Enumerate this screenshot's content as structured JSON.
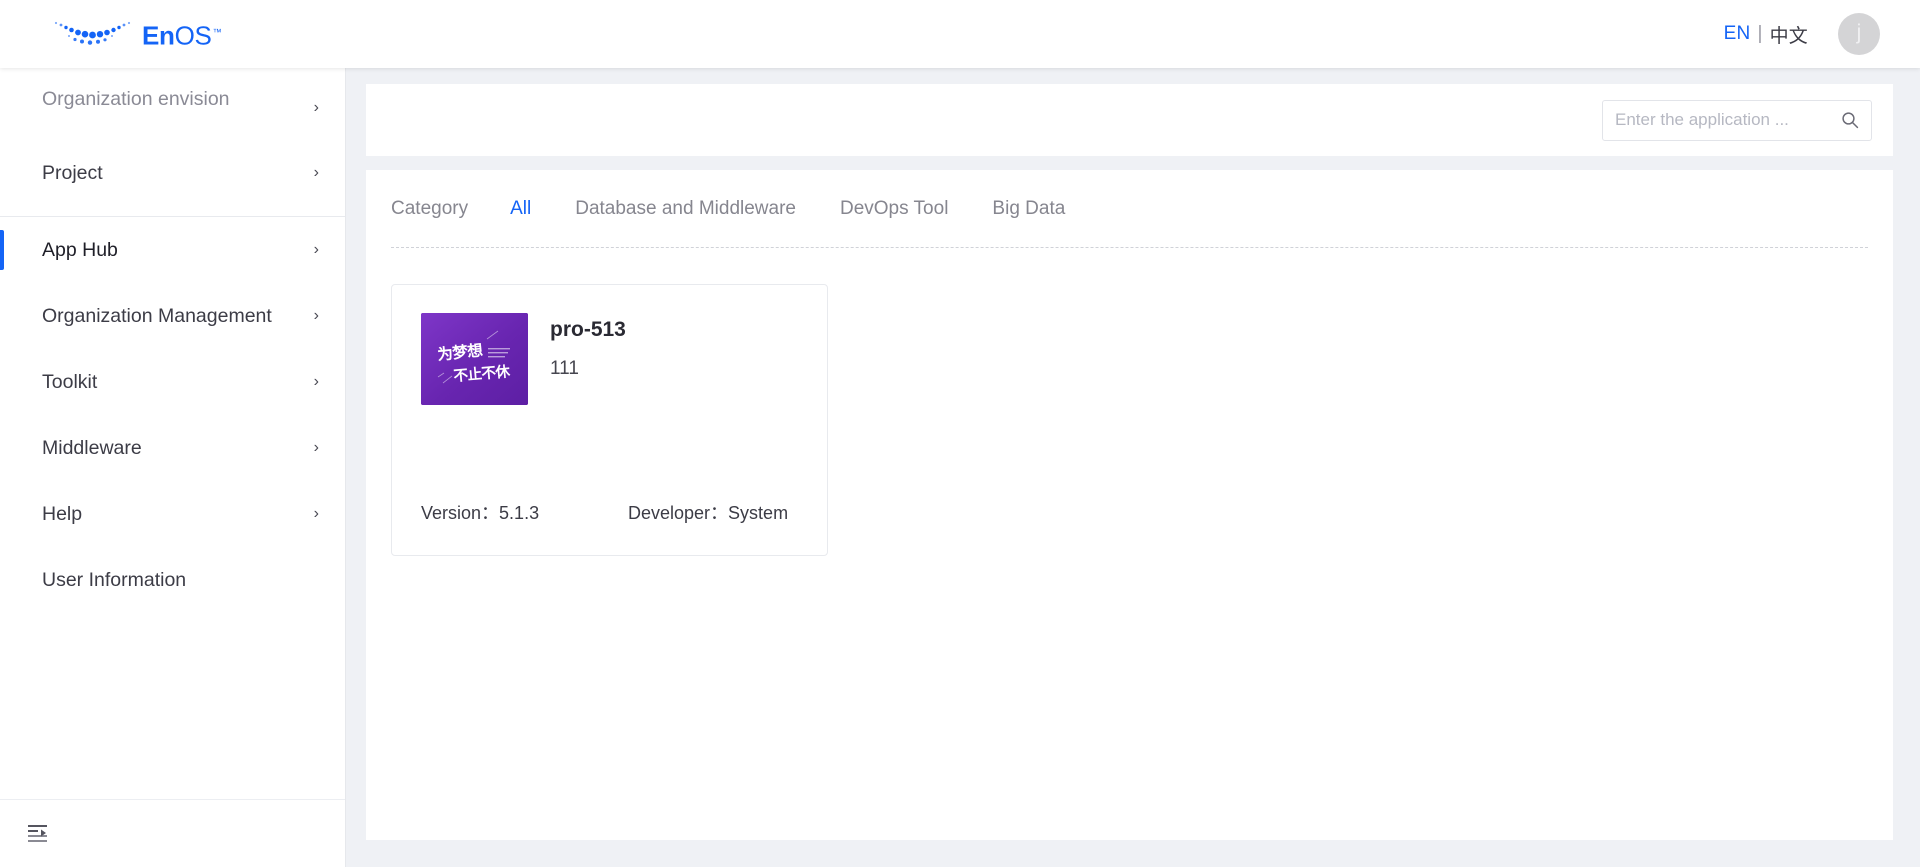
{
  "header": {
    "logo_text_en": "En",
    "logo_text_os": "OS",
    "logo_tm": "™",
    "logo_icon": "enos-dots-smile-logo",
    "lang_en": "EN",
    "lang_separator": "|",
    "lang_zh": "中文",
    "avatar_initial": "j",
    "accent_color": "#1464f6"
  },
  "sidebar": {
    "items": [
      {
        "label": "Organization envision",
        "chevron": "›",
        "muted": true,
        "two_line": true,
        "active": false
      },
      {
        "label": "Project",
        "chevron": "›",
        "muted": false,
        "two_line": false,
        "active": false
      },
      {
        "label": "App Hub",
        "chevron": "›",
        "muted": false,
        "two_line": false,
        "active": true
      },
      {
        "label": "Organization Management",
        "chevron": "›",
        "muted": false,
        "two_line": false,
        "active": false
      },
      {
        "label": "Toolkit",
        "chevron": "›",
        "muted": false,
        "two_line": false,
        "active": false
      },
      {
        "label": "Middleware",
        "chevron": "›",
        "muted": false,
        "two_line": false,
        "active": false
      },
      {
        "label": "Help",
        "chevron": "›",
        "muted": false,
        "two_line": false,
        "active": false
      },
      {
        "label": "User Information",
        "chevron": "",
        "muted": false,
        "two_line": false,
        "active": false
      }
    ],
    "collapse_icon": "menu-collapse-icon"
  },
  "search": {
    "placeholder": "Enter the application ...",
    "value": "",
    "icon": "search-icon"
  },
  "tabs": {
    "label": "Category",
    "items": [
      {
        "label": "All",
        "active": true
      },
      {
        "label": "Database and Middleware",
        "active": false
      },
      {
        "label": "DevOps Tool",
        "active": false
      },
      {
        "label": "Big Data",
        "active": false
      }
    ]
  },
  "apps": [
    {
      "title": "pro-513",
      "description": "111",
      "version_label": "Version：",
      "version_value": "5.1.3",
      "developer_label": "Developer：",
      "developer_value": "System",
      "thumbnail_text_line1": "为梦想",
      "thumbnail_text_line2": "不止不休",
      "thumbnail_color": "#6522ad"
    }
  ]
}
